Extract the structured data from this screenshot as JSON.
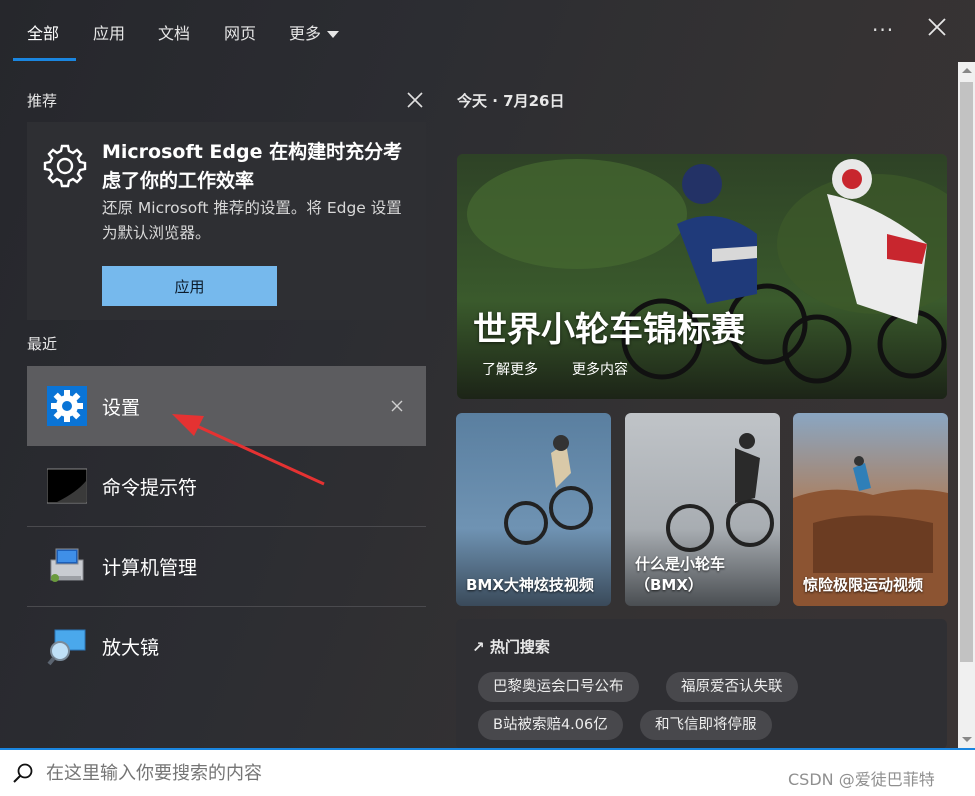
{
  "tabs": {
    "all": "全部",
    "apps": "应用",
    "docs": "文档",
    "web": "网页",
    "more": "更多"
  },
  "recommend": {
    "section_title": "推荐",
    "title": "Microsoft Edge 在构建时充分考虑了你的工作效率",
    "description": "还原 Microsoft 推荐的设置。将 Edge 设置为默认浏览器。",
    "apply_label": "应用"
  },
  "recent": {
    "section_title": "最近",
    "items": [
      {
        "label": "设置",
        "icon": "settings-gear-icon"
      },
      {
        "label": "命令提示符",
        "icon": "command-prompt-icon"
      },
      {
        "label": "计算机管理",
        "icon": "computer-management-icon"
      },
      {
        "label": "放大镜",
        "icon": "magnifier-icon"
      }
    ]
  },
  "today": {
    "label": "今天",
    "date": "7月26日"
  },
  "hero": {
    "title": "世界小轮车锦标赛",
    "link_learn": "了解更多",
    "link_more": "更多内容"
  },
  "tiles": [
    {
      "caption": "BMX大神炫技视频"
    },
    {
      "caption_line1": "什么是小轮车",
      "caption_line2": "（BMX）"
    },
    {
      "caption": "惊险极限运动视频"
    }
  ],
  "hot": {
    "title": "热门搜索",
    "chips": [
      "巴黎奥运会口号公布",
      "福原爱否认失联",
      "B站被索赔4.06亿",
      "和飞信即将停服"
    ]
  },
  "search": {
    "placeholder": "在这里输入你要搜索的内容"
  },
  "watermark": "CSDN @爱徒巴菲特",
  "colors": {
    "accent": "#1a86e0",
    "apply_button": "#76b9ed",
    "selected_item": "#5c5c5f",
    "annotation_arrow": "#e53232"
  }
}
